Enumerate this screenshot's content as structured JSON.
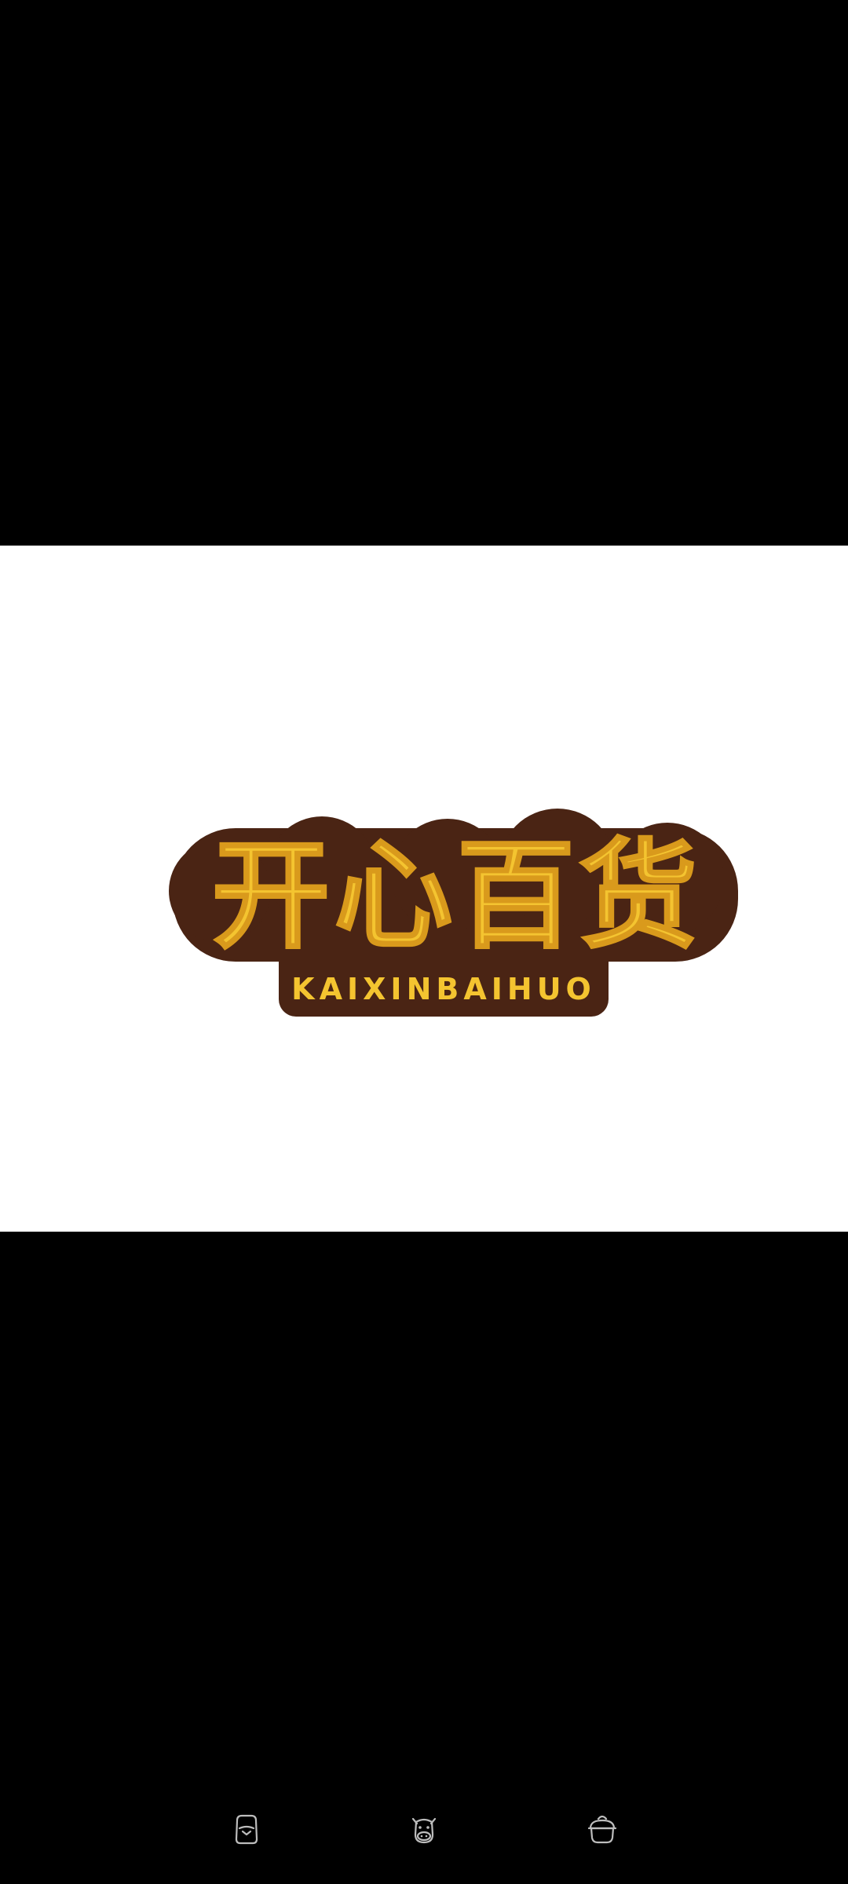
{
  "viewer": {
    "background_color": "#000000",
    "image_background_color": "#ffffff"
  },
  "logo": {
    "title_cn": "开心百货",
    "subtitle": "KAIXINBAIHUO",
    "fill_color": "#f4c430",
    "outline_color": "#4a2414"
  },
  "bottom_bar": {
    "icon_color": "#bdbdbd",
    "buttons": [
      {
        "icon": "jar-icon"
      },
      {
        "icon": "cow-face-icon"
      },
      {
        "icon": "pot-icon"
      }
    ]
  }
}
